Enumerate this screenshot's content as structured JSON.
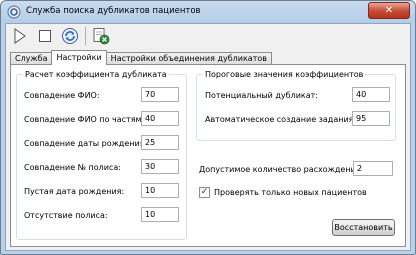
{
  "window": {
    "title": "Служба поиска дубликатов пациентов",
    "close_glyph": "✕"
  },
  "toolbar": {
    "icons": [
      "play-icon",
      "stop-icon",
      "refresh-icon",
      "delete-icon"
    ]
  },
  "tabs": [
    {
      "label": "Служба",
      "active": false
    },
    {
      "label": "Настройки",
      "active": true
    },
    {
      "label": "Настройки объединения дубликатов",
      "active": false
    }
  ],
  "coefficients": {
    "title": "Расчет коэффициента дубликата",
    "fields": [
      {
        "label": "Совпадение ФИО:",
        "value": "70"
      },
      {
        "label": "Совпадение ФИО по частям:",
        "value": "40"
      },
      {
        "label": "Совпадение даты рождения:",
        "value": "25"
      },
      {
        "label": "Совпадение № полиса:",
        "value": "30"
      },
      {
        "label": "Пустая дата рождения:",
        "value": "10"
      },
      {
        "label": "Отсутствие полиса:",
        "value": "10"
      }
    ]
  },
  "thresholds": {
    "title": "Пороговые значения коэффициентов",
    "fields": [
      {
        "label": "Потенциальный дубликат:",
        "value": "40"
      },
      {
        "label": "Автоматическое создание задания:",
        "value": "95"
      }
    ]
  },
  "discrepancies": {
    "label": "Допустимое количество расхождений:",
    "value": "2"
  },
  "new_only": {
    "label": "Проверять только новых пациентов",
    "checked": true,
    "check_glyph": "✓"
  },
  "restore_button": {
    "label": "Восстановить"
  }
}
